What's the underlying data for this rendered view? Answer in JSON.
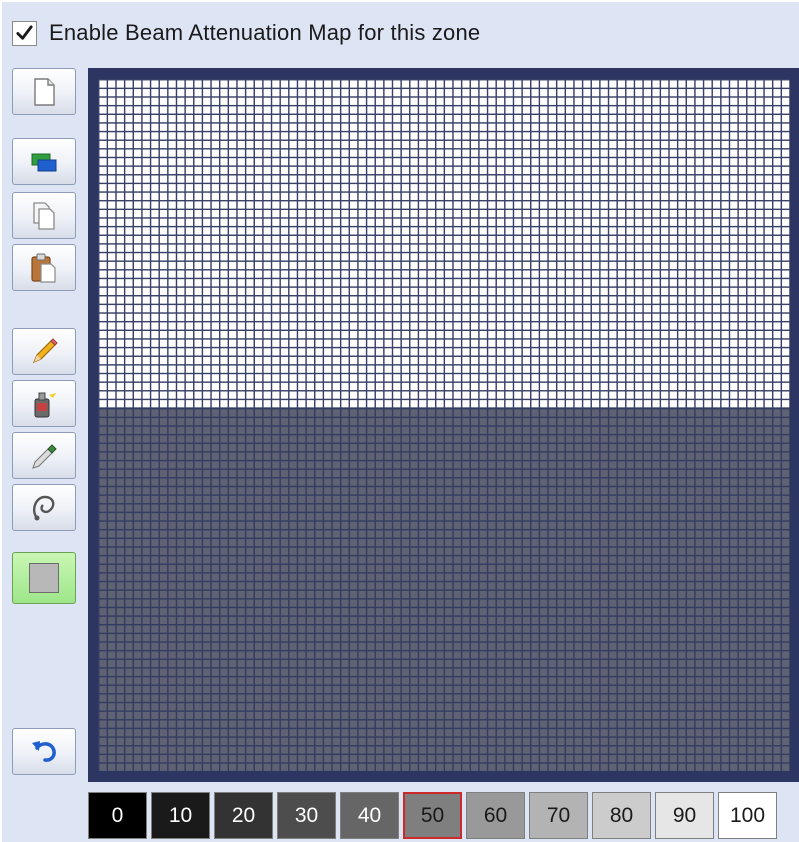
{
  "header": {
    "enable_checked": true,
    "enable_label": "Enable Beam Attenuation Map for this zone"
  },
  "toolbar": {
    "buttons": [
      {
        "name": "new-map-button",
        "icon": "blank-page-icon"
      },
      {
        "name": "layers-button",
        "icon": "layers-icon"
      },
      {
        "name": "copy-button",
        "icon": "copy-icon"
      },
      {
        "name": "paste-button",
        "icon": "clipboard-icon"
      },
      {
        "name": "pencil-tool-button",
        "icon": "pencil-icon"
      },
      {
        "name": "fill-tool-button",
        "icon": "paint-bucket-icon"
      },
      {
        "name": "eyedropper-tool-button",
        "icon": "eyedropper-icon"
      },
      {
        "name": "lasso-tool-button",
        "icon": "lasso-icon"
      },
      {
        "name": "current-color-button",
        "icon": "color-swatch-icon",
        "active": true
      },
      {
        "name": "undo-button",
        "icon": "undo-icon"
      }
    ]
  },
  "grid": {
    "rows": 80,
    "cols": 80,
    "upper_region_color": "#ffffff",
    "lower_region_color": "#5e6272",
    "grid_line_color": "#3a4168",
    "frame_color": "#2d3663"
  },
  "palette": {
    "selected": "50",
    "swatches": [
      {
        "label": "0",
        "bg": "#000000",
        "fg": "#ffffff"
      },
      {
        "label": "10",
        "bg": "#1a1a1a",
        "fg": "#ffffff"
      },
      {
        "label": "20",
        "bg": "#333333",
        "fg": "#ffffff"
      },
      {
        "label": "30",
        "bg": "#4d4d4d",
        "fg": "#ffffff"
      },
      {
        "label": "40",
        "bg": "#666666",
        "fg": "#ffffff"
      },
      {
        "label": "50",
        "bg": "#7f7f7f",
        "fg": "#1a1a1a"
      },
      {
        "label": "60",
        "bg": "#999999",
        "fg": "#1a1a1a"
      },
      {
        "label": "70",
        "bg": "#b3b3b3",
        "fg": "#1a1a1a"
      },
      {
        "label": "80",
        "bg": "#cccccc",
        "fg": "#1a1a1a"
      },
      {
        "label": "90",
        "bg": "#e6e6e6",
        "fg": "#1a1a1a"
      },
      {
        "label": "100",
        "bg": "#ffffff",
        "fg": "#1a1a1a"
      }
    ]
  }
}
